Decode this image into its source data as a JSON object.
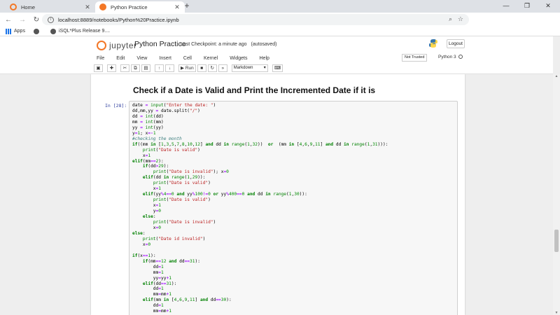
{
  "browser": {
    "tabs": [
      {
        "title": "Home",
        "active": false,
        "favicon_color": "#f37726"
      },
      {
        "title": "Python Practice",
        "active": true,
        "favicon_color": "#f37726"
      }
    ],
    "new_tab_symbol": "+",
    "window_controls": [
      "—",
      "❐",
      "✕"
    ],
    "url": "localhost:8889/notebooks/Python%20Practice.ipynb",
    "bookmarks": [
      {
        "label": "Apps"
      },
      {
        "label": ""
      },
      {
        "label": "iSQL*Plus Release 9...."
      }
    ]
  },
  "jupyter": {
    "logo_text": "jupyter",
    "notebook_title": "Python Practice",
    "checkpoint": "Last Checkpoint: a minute ago",
    "autosave": "(autosaved)",
    "logout_label": "Logout",
    "menu": [
      "File",
      "Edit",
      "View",
      "Insert",
      "Cell",
      "Kernel",
      "Widgets",
      "Help"
    ],
    "trust_label": "Not Trusted",
    "kernel_name": "Python 3",
    "toolbar": {
      "run_label": "Run",
      "cell_type": "Markdown"
    }
  },
  "notebook": {
    "heading": "Check if a Date is Valid and Print the Incremented Date if it is",
    "prompt": "In [28]:",
    "code_lines": [
      "date = input(\"Enter the date: \")",
      "dd,mm,yy = date.split(\"/\")",
      "dd = int(dd)",
      "mm = int(mm)",
      "yy = int(yy)",
      "y=1; x=-1",
      "#checking the month",
      "if((mm in [1,3,5,7,8,10,12] and dd in range(1,32))  or  (mm in [4,6,9,11] and dd in range(1,31))):",
      "    print(\"Date is valid\")",
      "    x=1",
      "elif(mm==2):",
      "    if(dd>29):",
      "        print(\"Date is invalid\"); x=0",
      "    elif(dd in range(1,29)):",
      "        print(\"Date is valid\")",
      "        x=1",
      "    elif(yy%4==0 and yy%100!=0 or yy%400==0 and dd in range(1,30)):",
      "        print(\"Date is valid\")",
      "        x=1",
      "        y=0",
      "    else:",
      "        print(\"Date is invalid\")",
      "        x=0",
      "else:",
      "    print(\"Date id invalid\")",
      "    x=0",
      "",
      "if(x==1):",
      "    if(mm==12 and dd==31):",
      "        dd=1",
      "        mm=1",
      "        yy=yy+1",
      "    elif(dd==31):",
      "        dd=1",
      "        mm=mm+1",
      "    elif(mm in [4,6,9,11] and dd==30):",
      "        dd=1",
      "        mm=mm+1"
    ]
  }
}
